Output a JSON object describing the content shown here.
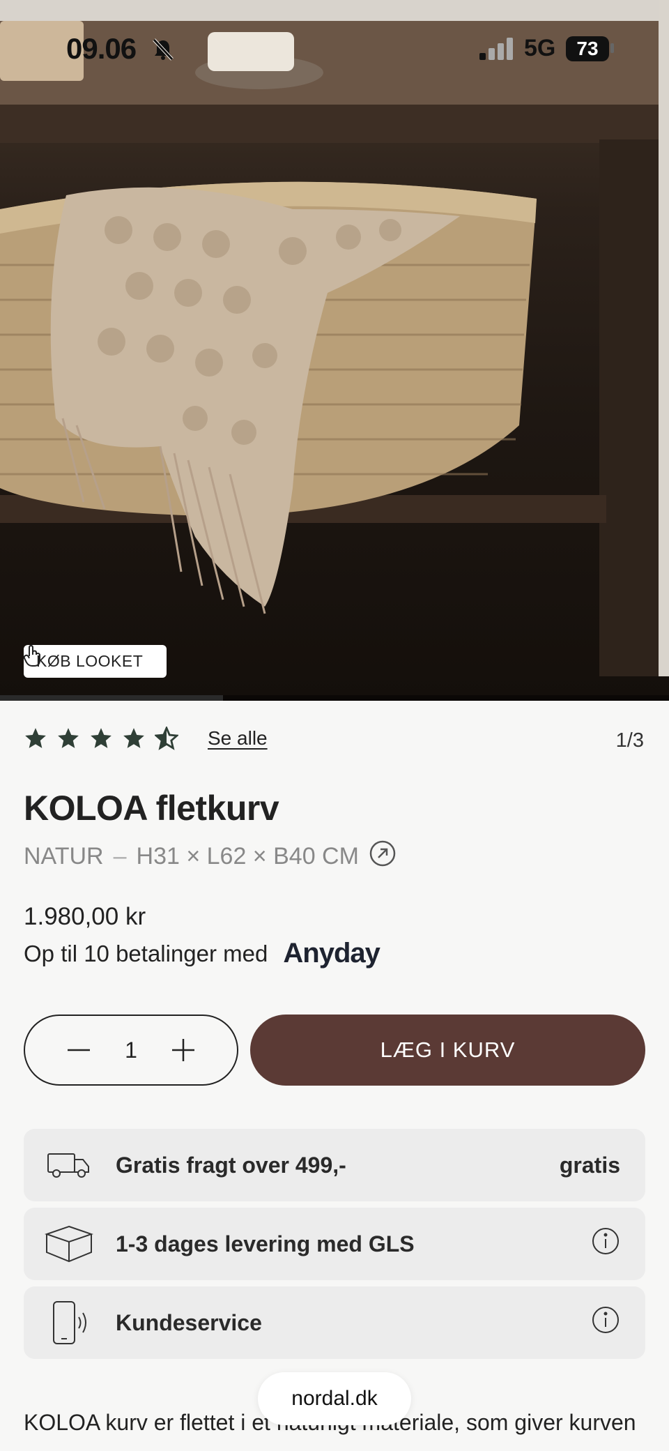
{
  "status_bar": {
    "time": "09.06",
    "network": "5G",
    "battery": "73"
  },
  "hero": {
    "buy_look_label": "KØB LOOKET"
  },
  "rating": {
    "stars": 4.5,
    "see_all_label": "Se alle",
    "pager": "1/3"
  },
  "product": {
    "title": "KOLOA fletkurv",
    "color": "NATUR",
    "dimensions": "H31 × L62 × B40 CM",
    "price": "1.980,00 kr",
    "installments_text": "Op til 10 betalinger med",
    "installments_provider": "Anyday"
  },
  "cart": {
    "quantity": "1",
    "add_label": "LÆG I KURV"
  },
  "info_rows": [
    {
      "label": "Gratis fragt over 499,-",
      "right": "gratis",
      "icon": "truck-icon"
    },
    {
      "label": "1-3 dages levering med GLS",
      "icon": "box-icon"
    },
    {
      "label": "Kundeservice",
      "icon": "phone-icon"
    }
  ],
  "description_start": "KOLOA kurv er flettet i et naturligt materiale, som giver kurven",
  "browser": {
    "domain": "nordal.dk"
  },
  "colors": {
    "accent": "#5b3a35",
    "stars": "#2f3f36",
    "info_bg": "#ececec"
  }
}
